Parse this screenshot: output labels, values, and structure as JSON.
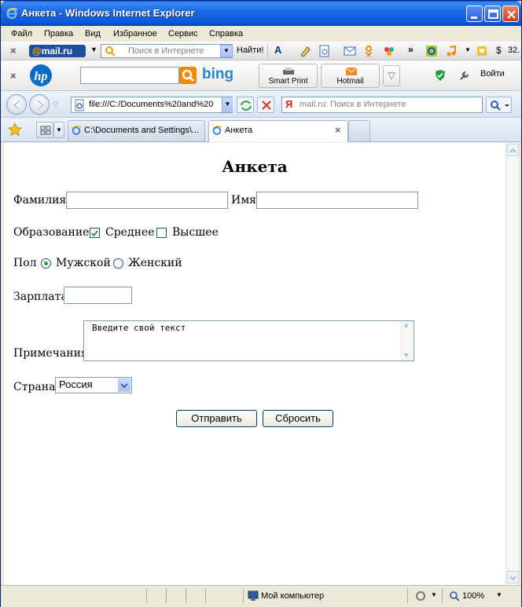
{
  "window": {
    "title": "Анкета - Windows Internet Explorer"
  },
  "menu": [
    "Файл",
    "Правка",
    "Вид",
    "Избранное",
    "Сервис",
    "Справка"
  ],
  "toolbar1": {
    "mailru_prefix": "@",
    "mailru_label": "mail.ru",
    "search_placeholder": "Поиск в Интернете",
    "find_label": "Найти!",
    "balance_label": "$",
    "balance_value": "32."
  },
  "toolbar2": {
    "bing_label": "bing",
    "smart_print_label": "Smart Print",
    "hotmail_label": "Hotmail",
    "signin_label": "Войти"
  },
  "address": {
    "url": "file:///C:/Documents%20and%20",
    "search_placeholder": "mail.ru: Поиск в Интернете"
  },
  "tabs": [
    {
      "label": "C:\\Documents and Settings\\..."
    },
    {
      "label": "Анкета",
      "active": true
    }
  ],
  "form": {
    "title": "Анкета",
    "surname_label": "Фамилия",
    "surname_value": "",
    "name_label": "Имя",
    "name_value": "",
    "education_label": "Образование",
    "education_options": [
      {
        "label": "Среднее",
        "checked": true
      },
      {
        "label": "Высшее",
        "checked": false
      }
    ],
    "gender_label": "Пол",
    "gender_options": [
      {
        "label": "Мужской",
        "selected": true
      },
      {
        "label": "Женский",
        "selected": false
      }
    ],
    "salary_label": "Зарплата",
    "salary_value": "",
    "notes_label": "Примечания",
    "notes_value": "Введите свой текст",
    "country_label": "Страна",
    "country_value": "Россия",
    "submit_label": "Отправить",
    "reset_label": "Сбросить"
  },
  "status": {
    "zone": "Мой компьютер",
    "zoom": "100%"
  },
  "colors": {
    "titlebar": "#0b57d8",
    "checkmark": "#2aa32a",
    "button_border": "#003c74"
  }
}
